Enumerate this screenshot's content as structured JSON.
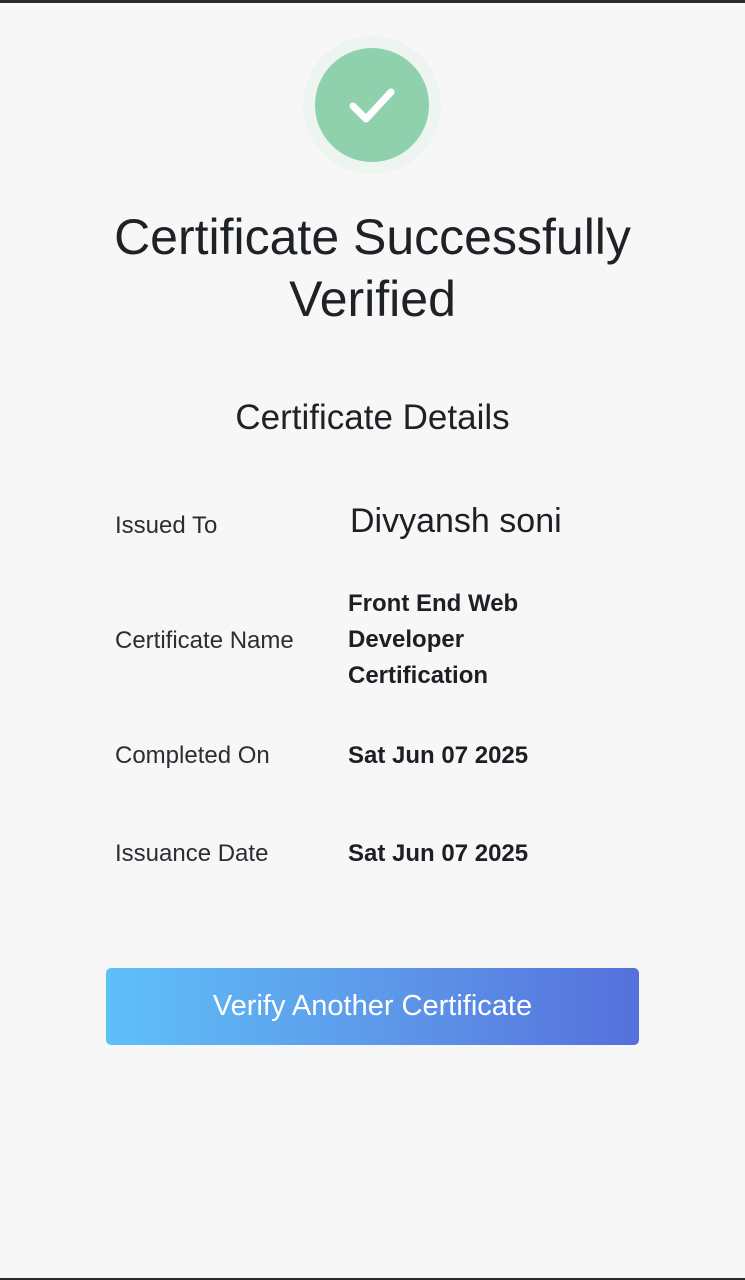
{
  "status": {
    "icon": "checkmark-icon",
    "badge_color": "#8fd0ad",
    "title": "Certificate Successfully Verified"
  },
  "details": {
    "heading": "Certificate Details",
    "rows": [
      {
        "label": "Issued To",
        "value": "Divyansh soni"
      },
      {
        "label": "Certificate Name",
        "value": "Front End Web Developer Certification"
      },
      {
        "label": "Completed On",
        "value": "Sat Jun 07 2025"
      },
      {
        "label": "Issuance Date",
        "value": "Sat Jun 07 2025"
      }
    ]
  },
  "actions": {
    "verify_another_label": "Verify Another Certificate",
    "button_gradient": [
      "#5ec0f8",
      "#5570dc"
    ]
  }
}
